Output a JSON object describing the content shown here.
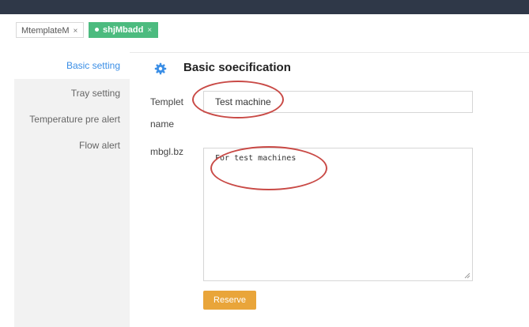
{
  "tabs": [
    {
      "label": "MtemplateM",
      "close": "×"
    },
    {
      "label": "shjMbadd",
      "close": "×"
    }
  ],
  "sidebar": {
    "items": [
      {
        "label": "Basic setting"
      },
      {
        "label": "Tray setting"
      },
      {
        "label": "Temperature pre alert"
      },
      {
        "label": "Flow alert"
      }
    ]
  },
  "main": {
    "title": "Basic soecification",
    "title_icon": "gear-icon",
    "fields": {
      "templet_label_line1": "Templet",
      "templet_label_line2": "name",
      "templet_value": "Test machine",
      "note_label": "mbgl.bz",
      "note_value": "For test machines"
    },
    "reserve_label": "Reserve"
  },
  "colors": {
    "topbar": "#2f3848",
    "active_tab": "#4cbb7f",
    "sidebar_bg": "#f2f2f2",
    "active_side_text": "#3a8ee6",
    "button": "#e9a53a",
    "annotation": "#c94a46"
  }
}
